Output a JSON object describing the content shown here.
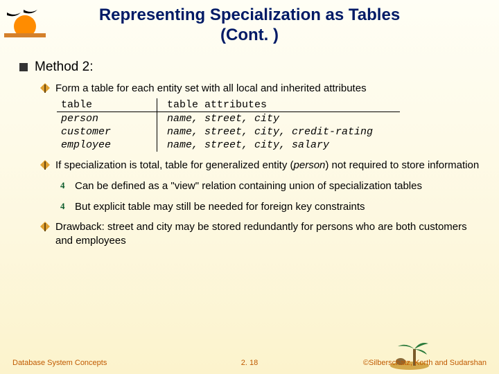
{
  "title_line1": "Representing Specialization as Tables",
  "title_line2": "(Cont. )",
  "heading": "Method 2:",
  "bullets": {
    "b1": "Form a table for each entity set with all local and inherited attributes",
    "b2_a": "If specialization is total, table for generalized entity (",
    "b2_b": "person",
    "b2_c": ") not required to store information",
    "b2_sub1": "Can be defined as a \"view\" relation containing union of specialization tables",
    "b2_sub2": "But explicit table may still be needed for foreign key constraints",
    "b3": "Drawback:  street and city may be stored redundantly for persons who are both customers and employees"
  },
  "schema": {
    "h1": "table",
    "h2": "table attributes",
    "rows": [
      {
        "name": "person",
        "attrs": "name, street, city"
      },
      {
        "name": "customer",
        "attrs": "name, street, city, credit-rating"
      },
      {
        "name": "employee",
        "attrs": "name, street, city, salary"
      }
    ]
  },
  "footer": {
    "left": "Database System Concepts",
    "center": "2. 18",
    "right": "©Silberschatz, Korth and Sudarshan"
  },
  "icons": {
    "sign": "sign-icon",
    "four": "four-icon"
  }
}
